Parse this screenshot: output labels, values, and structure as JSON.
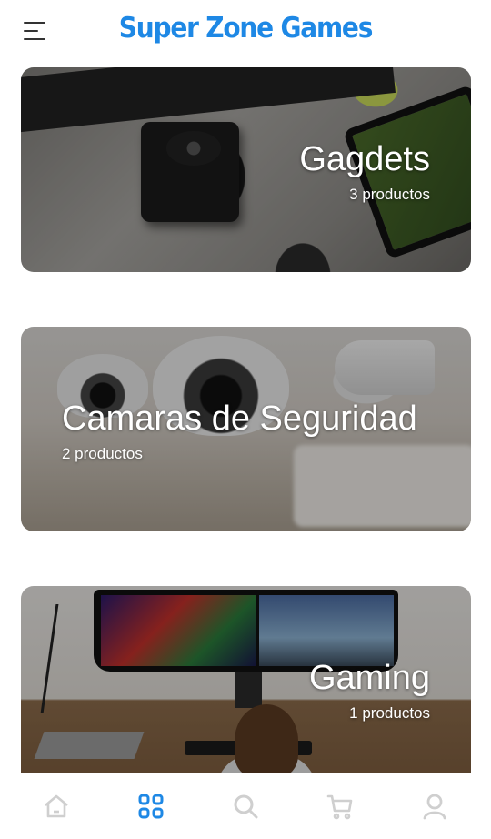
{
  "header": {
    "brand": "Super Zone Games",
    "menu_icon": "hamburger-menu-icon"
  },
  "categories": [
    {
      "title": "Gagdets",
      "subtitle": "3 productos",
      "alignment": "right"
    },
    {
      "title": "Camaras de Seguridad",
      "subtitle": "2 productos",
      "alignment": "left"
    },
    {
      "title": "Gaming",
      "subtitle": "1 productos",
      "alignment": "right"
    }
  ],
  "bottom_nav": {
    "items": [
      {
        "icon": "home-icon",
        "active": false
      },
      {
        "icon": "grid-icon",
        "active": true
      },
      {
        "icon": "search-icon",
        "active": false
      },
      {
        "icon": "cart-icon",
        "active": false
      },
      {
        "icon": "user-icon",
        "active": false
      }
    ]
  },
  "colors": {
    "brand": "#1e88e5",
    "nav_active": "#1e88e5",
    "nav_inactive": "#cfcfcf"
  }
}
